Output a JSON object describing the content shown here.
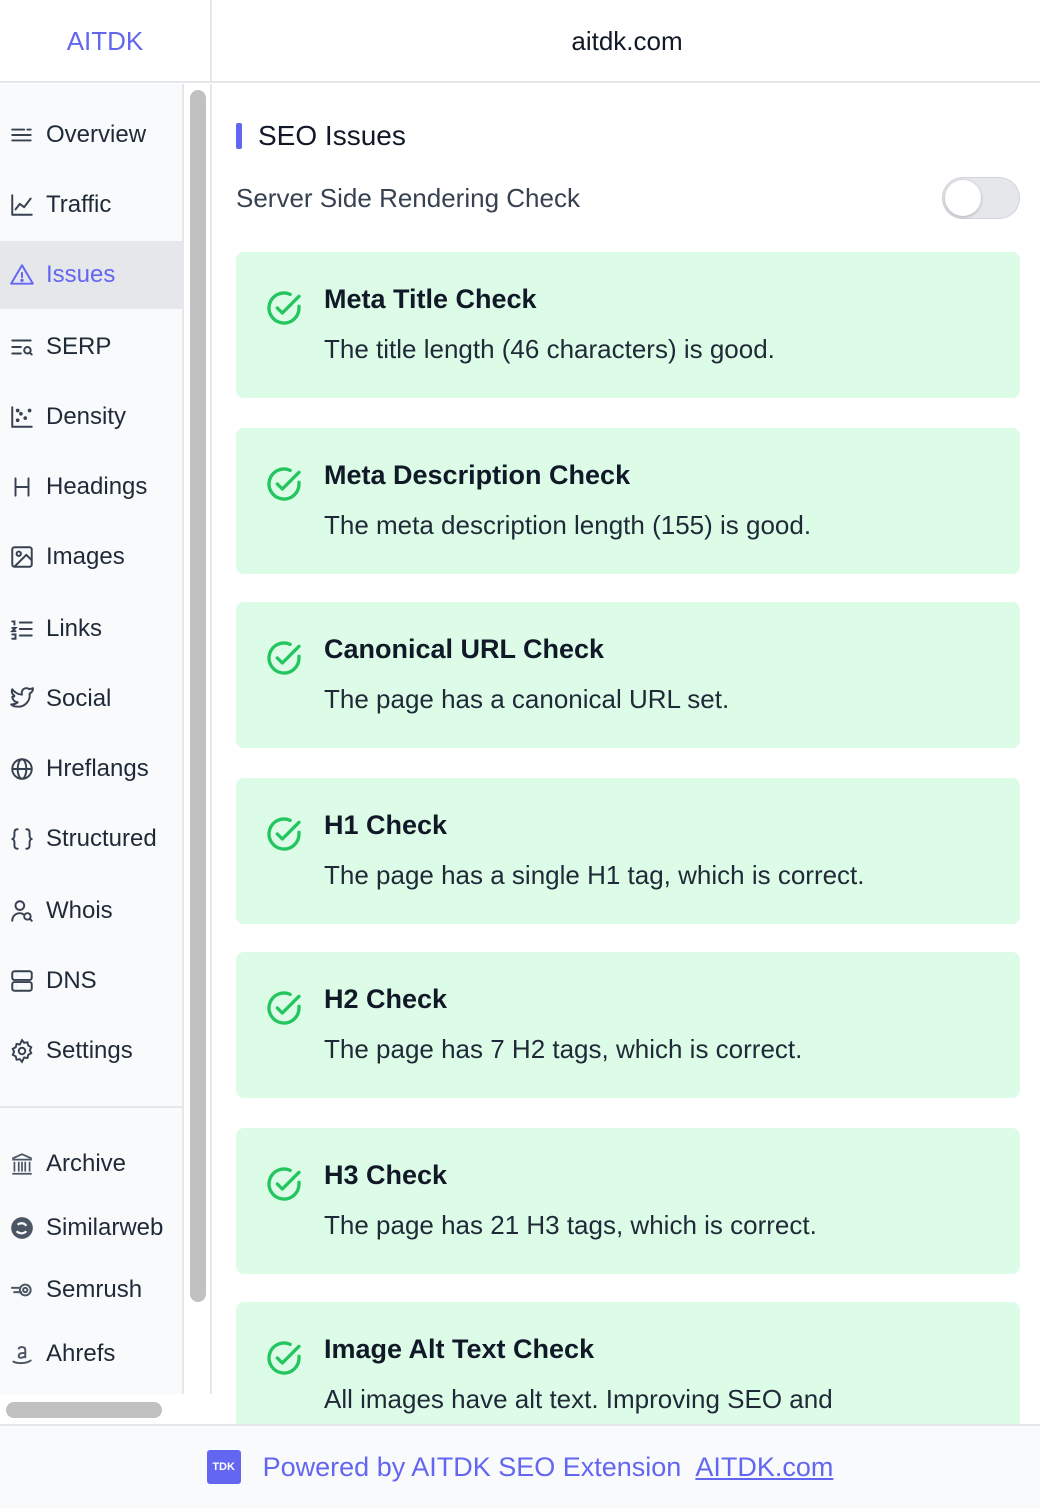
{
  "header": {
    "brand": "AITDK",
    "domain": "aitdk.com"
  },
  "sidebar": {
    "items": [
      {
        "label": "Overview",
        "icon": "overview-icon"
      },
      {
        "label": "Traffic",
        "icon": "traffic-chart-icon"
      },
      {
        "label": "Issues",
        "icon": "warning-triangle-icon",
        "active": true
      },
      {
        "label": "SERP",
        "icon": "serp-search-icon"
      },
      {
        "label": "Density",
        "icon": "scatter-plot-icon"
      },
      {
        "label": "Headings",
        "icon": "heading-h-icon"
      },
      {
        "label": "Images",
        "icon": "image-icon"
      },
      {
        "label": "Links",
        "icon": "list-ordered-icon"
      },
      {
        "label": "Social",
        "icon": "twitter-bird-icon"
      },
      {
        "label": "Hreflangs",
        "icon": "globe-icon"
      },
      {
        "label": "Structured",
        "icon": "curly-braces-icon"
      },
      {
        "label": "Whois",
        "icon": "user-search-icon"
      },
      {
        "label": "DNS",
        "icon": "server-icon"
      },
      {
        "label": "Settings",
        "icon": "gear-icon"
      }
    ],
    "external": [
      {
        "label": "Archive",
        "icon": "archive-building-icon"
      },
      {
        "label": "Similarweb",
        "icon": "similarweb-icon"
      },
      {
        "label": "Semrush",
        "icon": "semrush-icon"
      },
      {
        "label": "Ahrefs",
        "icon": "amazon-a-icon"
      }
    ]
  },
  "main": {
    "section_title": "SEO Issues",
    "ssr_label": "Server Side Rendering Check",
    "ssr_enabled": false,
    "accent": "#6366f1",
    "success_bg": "#dcfce7",
    "success_color": "#22c55e",
    "checks": [
      {
        "title": "Meta Title Check",
        "desc": "The title length (46 characters) is good."
      },
      {
        "title": "Meta Description Check",
        "desc": "The meta description length (155) is good."
      },
      {
        "title": "Canonical URL Check",
        "desc": "The page has a canonical URL set."
      },
      {
        "title": "H1 Check",
        "desc": "The page has a single H1 tag, which is correct."
      },
      {
        "title": "H2 Check",
        "desc": "The page has 7 H2 tags, which is correct."
      },
      {
        "title": "H3 Check",
        "desc": "The page has 21 H3 tags, which is correct."
      },
      {
        "title": "Image Alt Text Check",
        "desc": "All images have alt text. Improving SEO and"
      }
    ]
  },
  "footer": {
    "logo_text": "TDK",
    "powered": "Powered by AITDK SEO Extension",
    "link": "AITDK.com"
  }
}
